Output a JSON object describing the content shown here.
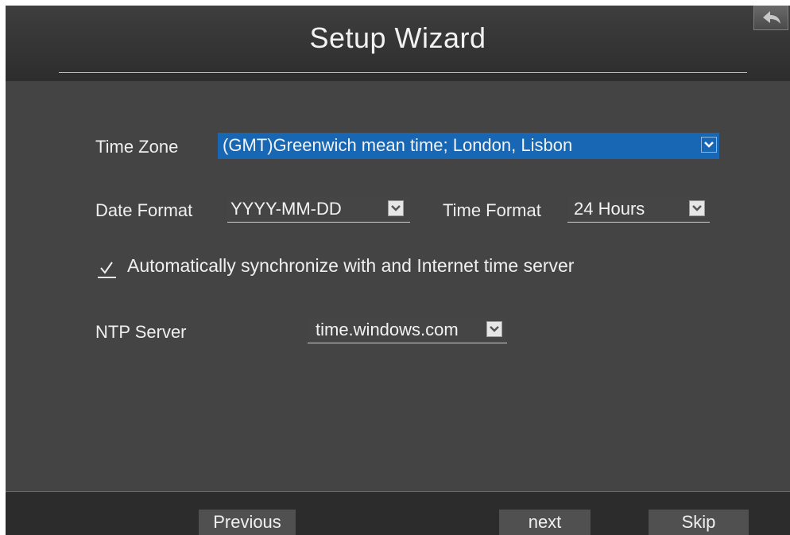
{
  "header": {
    "title": "Setup Wizard",
    "back_icon": "back-arrow-icon"
  },
  "form": {
    "time_zone": {
      "label": "Time Zone",
      "value": "(GMT)Greenwich mean time; London, Lisbon"
    },
    "date_format": {
      "label": "Date Format",
      "value": "YYYY-MM-DD"
    },
    "time_format": {
      "label": "Time Format",
      "value": "24 Hours"
    },
    "auto_sync": {
      "checked": true,
      "label": "Automatically synchronize with and Internet time server"
    },
    "ntp_server": {
      "label": "NTP Server",
      "value": "time.windows.com"
    }
  },
  "footer": {
    "previous_label": "Previous",
    "next_label": "next",
    "skip_label": "Skip"
  },
  "colors": {
    "background": "#444444",
    "header": "#333333",
    "footer": "#2c2c2c",
    "selection_blue": "#1767b4",
    "button": "#505050",
    "text": "#efefef"
  }
}
